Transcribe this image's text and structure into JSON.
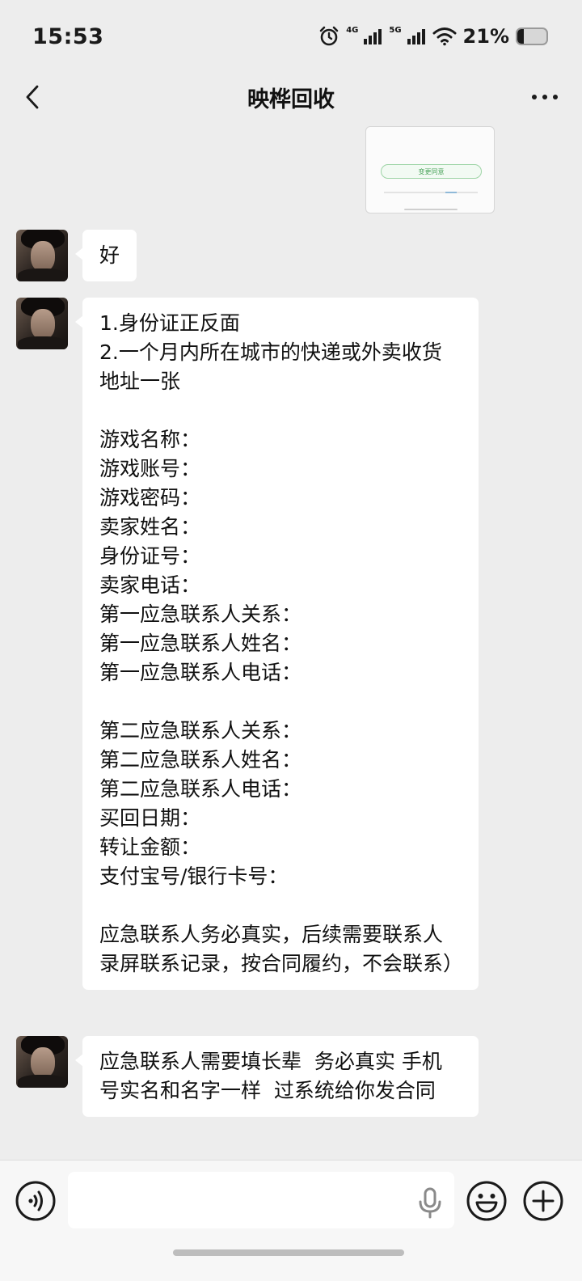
{
  "status_bar": {
    "time": "15:53",
    "network_1": "4G",
    "network_2": "5G",
    "battery_percent": "21%",
    "battery_level": 0.21
  },
  "nav": {
    "title": "映桦回收"
  },
  "shared_card": {
    "button_label": "变更同意"
  },
  "messages": [
    {
      "sender": "contact",
      "text": "好"
    },
    {
      "sender": "contact",
      "text": "1.身份证正反面\n2.一个月内所在城市的快递或外卖收货地址一张\n\n游戏名称：\n游戏账号：\n游戏密码：\n卖家姓名：\n身份证号：\n卖家电话：\n第一应急联系人关系：\n第一应急联系人姓名：\n第一应急联系人电话：\n\n第二应急联系人关系：\n第二应急联系人姓名：\n第二应急联系人电话：\n买回日期：\n转让金额：\n支付宝号/银行卡号：\n\n应急联系人务必真实，后续需要联系人录屏联系记录，按合同履约，不会联系）"
    },
    {
      "sender": "contact",
      "text": "应急联系人需要填长辈  务必真实 手机号实名和名字一样  过系统给你发合同"
    }
  ],
  "input_bar": {
    "value": "",
    "voice_icon": "voice-icon",
    "mic_icon": "mic-icon",
    "emoji_icon": "emoji-icon",
    "plus_icon": "plus-icon"
  }
}
